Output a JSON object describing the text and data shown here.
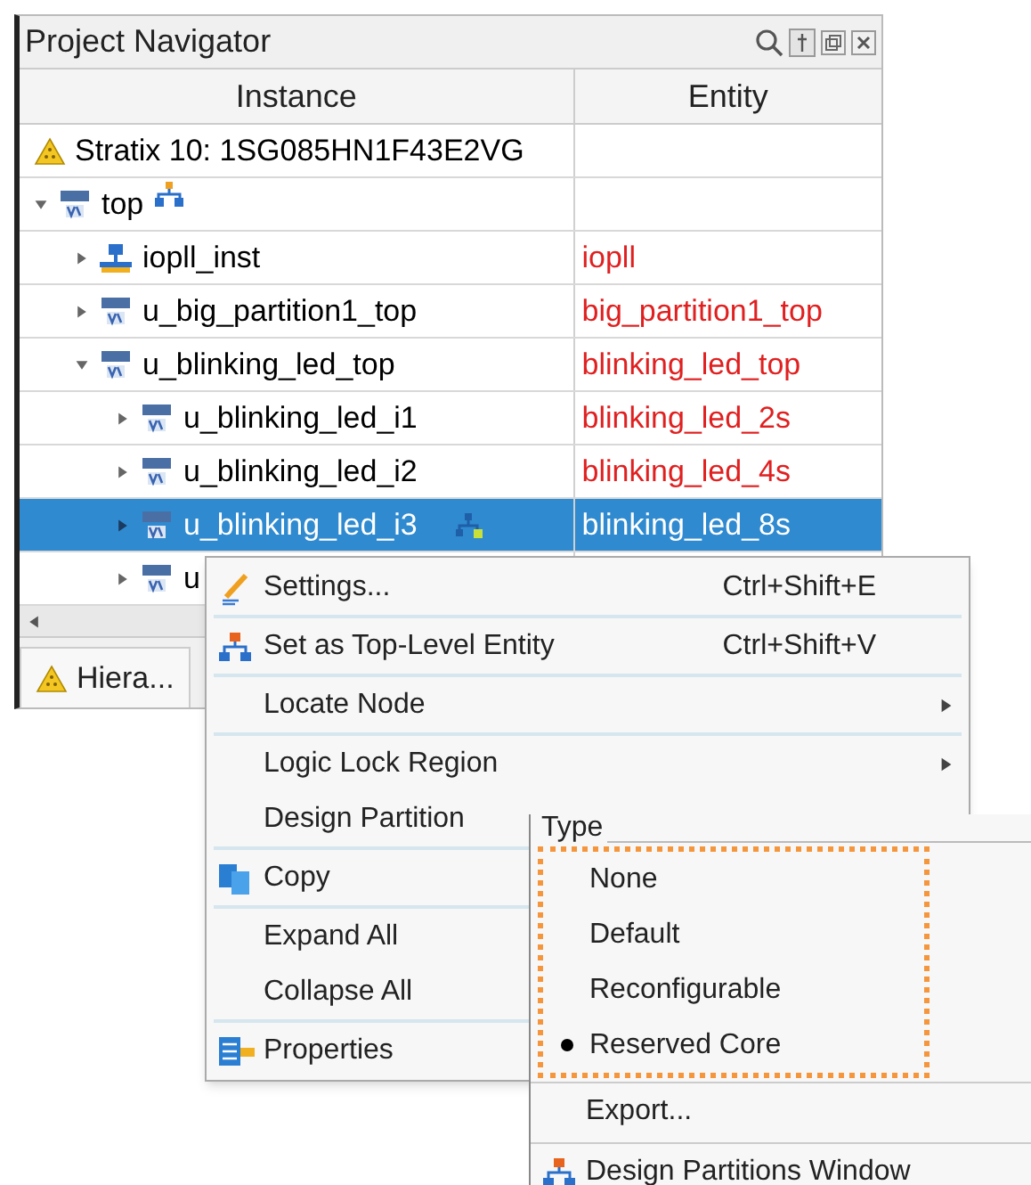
{
  "panel": {
    "title": "Project Navigator",
    "columns": [
      "Instance",
      "Entity"
    ],
    "tree": [
      {
        "kind": "device",
        "label": "Stratix 10: 1SG085HN1F43E2VG",
        "selected": false,
        "top_level": false,
        "partition": false
      },
      {
        "kind": "sv",
        "label": "top",
        "top_level": true,
        "partition": false,
        "expanded": true,
        "selected": false,
        "children": [
          {
            "kind": "ip",
            "label": "iopll_inst",
            "entity": "iopll",
            "expanded": false,
            "selected": false,
            "top_level": false,
            "partition": false
          },
          {
            "kind": "v",
            "label": "u_big_partition1_top",
            "entity": "big_partition1_top",
            "expanded": false,
            "selected": false,
            "top_level": false,
            "partition": false
          },
          {
            "kind": "v",
            "label": "u_blinking_led_top",
            "entity": "blinking_led_top",
            "expanded": true,
            "selected": false,
            "top_level": false,
            "partition": false,
            "children": [
              {
                "kind": "sv",
                "label": "u_blinking_led_i1",
                "entity": "blinking_led_2s",
                "expanded": false,
                "selected": false,
                "top_level": false,
                "partition": false
              },
              {
                "kind": "sv",
                "label": "u_blinking_led_i2",
                "entity": "blinking_led_4s",
                "expanded": false,
                "selected": false,
                "top_level": false,
                "partition": false
              },
              {
                "kind": "sv",
                "label": "u_blinking_led_i3",
                "entity": "blinking_led_8s",
                "partition": true,
                "top_level": false,
                "expanded": false,
                "selected": true
              },
              {
                "kind": "sv",
                "label": "u",
                "expanded": false,
                "selected": false,
                "top_level": false,
                "partition": false
              }
            ]
          }
        ]
      }
    ],
    "tab": "Hiera..."
  },
  "context_menu": [
    {
      "kind": "pencil",
      "label": "Settings...",
      "shortcut": "Ctrl+Shift+E",
      "submenu": false
    },
    {
      "kind": "separator"
    },
    {
      "kind": "hierarchy",
      "label": "Set as Top-Level Entity",
      "shortcut": "Ctrl+Shift+V",
      "submenu": false
    },
    {
      "kind": "separator"
    },
    {
      "kind": "plain",
      "label": "Locate Node",
      "submenu": true
    },
    {
      "kind": "separator"
    },
    {
      "kind": "plain",
      "label": "Logic Lock Region",
      "submenu": true
    },
    {
      "kind": "plain",
      "label": "Design Partition",
      "submenu": true
    },
    {
      "kind": "separator"
    },
    {
      "kind": "copy",
      "label": "Copy",
      "submenu": false
    },
    {
      "kind": "separator"
    },
    {
      "kind": "plain",
      "label": "Expand All",
      "submenu": false
    },
    {
      "kind": "plain",
      "label": "Collapse All",
      "submenu": false
    },
    {
      "kind": "separator"
    },
    {
      "kind": "properties",
      "label": "Properties",
      "submenu": false
    }
  ],
  "submenu": {
    "heading": "Type",
    "options": [
      {
        "label": "None",
        "selected": false
      },
      {
        "label": "Default",
        "selected": false
      },
      {
        "label": "Reconfigurable",
        "selected": false
      },
      {
        "label": "Reserved Core",
        "selected": true
      }
    ],
    "items": [
      {
        "kind": "plain",
        "label": "Export..."
      },
      {
        "kind": "hierarchy",
        "label": "Design Partitions Window"
      }
    ]
  }
}
